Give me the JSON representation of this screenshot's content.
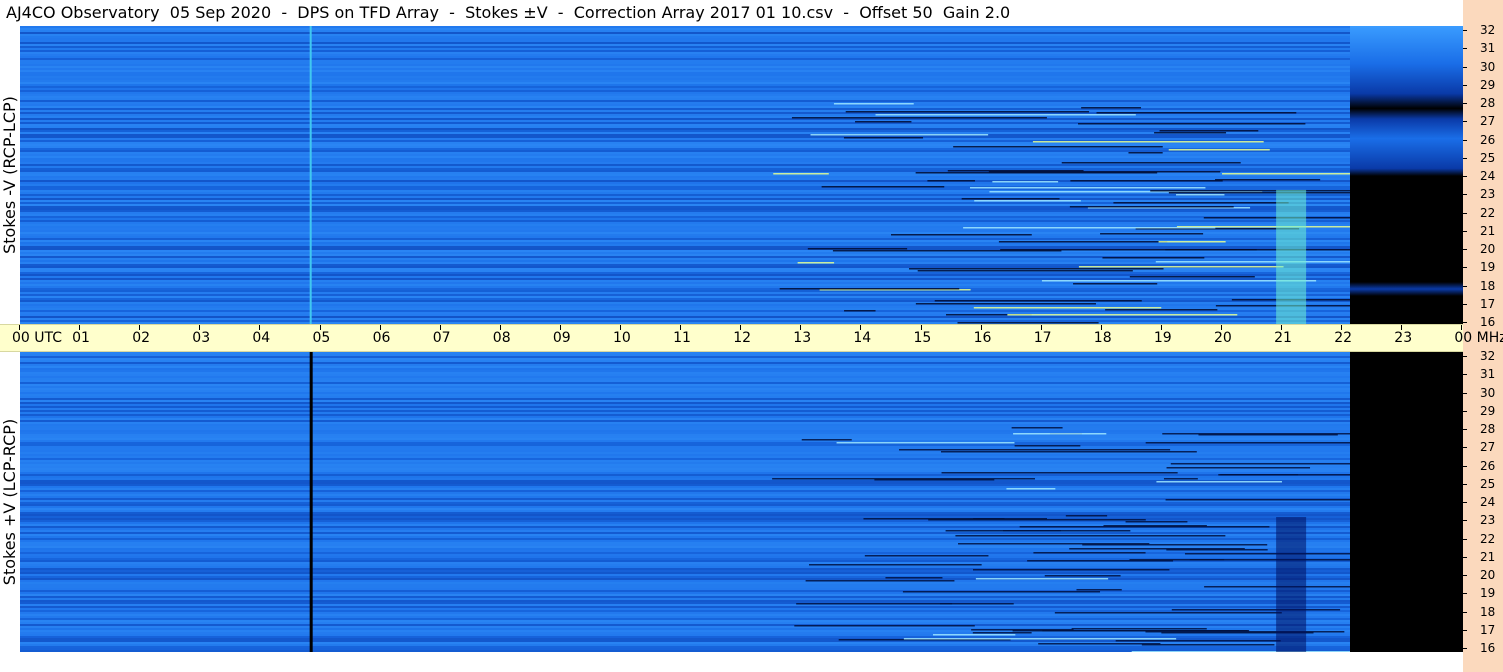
{
  "title": "AJ4CO Observatory  05 Sep 2020  -  DPS on TFD Array  -  Stokes ±V  -  Correction Array 2017 01 10.csv  -  Offset 50  Gain 2.0",
  "panels": {
    "top_label": "Stokes -V (RCP-LCP)",
    "bottom_label": "Stokes +V (LCP-RCP)"
  },
  "chart_data": {
    "type": "heatmap",
    "title": "AJ4CO Observatory  05 Sep 2020  -  DPS on TFD Array  -  Stokes ±V  -  Correction Array 2017 01 10.csv  -  Offset 50  Gain 2.0",
    "x_unit": "UTC",
    "y_unit": "MHz",
    "x_ticks": [
      "00",
      "01",
      "02",
      "03",
      "04",
      "05",
      "06",
      "07",
      "08",
      "09",
      "10",
      "11",
      "12",
      "13",
      "14",
      "15",
      "16",
      "17",
      "18",
      "19",
      "20",
      "21",
      "22",
      "23",
      "00"
    ],
    "x_tick_first": "00 UTC",
    "x_tick_last": "00 MHz",
    "y_ticks": [
      "32",
      "31",
      "30",
      "29",
      "28",
      "27",
      "26",
      "25",
      "24",
      "23",
      "22",
      "21",
      "20",
      "19",
      "18",
      "17",
      "16"
    ],
    "xlim": [
      0,
      24
    ],
    "ylim": [
      16,
      32
    ],
    "data_end_hour": 22.15,
    "series": [
      {
        "name": "Stokes -V (RCP-LCP)",
        "vertical_line_hour": 4.82,
        "vertical_line_color": "#40c8f0",
        "activity_hours": [
          [
            12.5,
            22.1
          ]
        ],
        "bright_burst_hour": 21.1
      },
      {
        "name": "Stokes +V (LCP-RCP)",
        "vertical_line_hour": 4.82,
        "vertical_line_color": "#000000",
        "activity_hours": [
          [
            12.5,
            22.1
          ]
        ],
        "bright_burst_hour": 21.1
      }
    ],
    "colors": {
      "background_blue": "#1a6ee8",
      "dark_blue": "#0a3aa8",
      "light_blue": "#3a9cff",
      "cyan_line": "#40c8f0",
      "no_data": "#000000",
      "axis_band": "#ffffcc",
      "right_strip": "#fbd9bd"
    },
    "grid": false
  }
}
